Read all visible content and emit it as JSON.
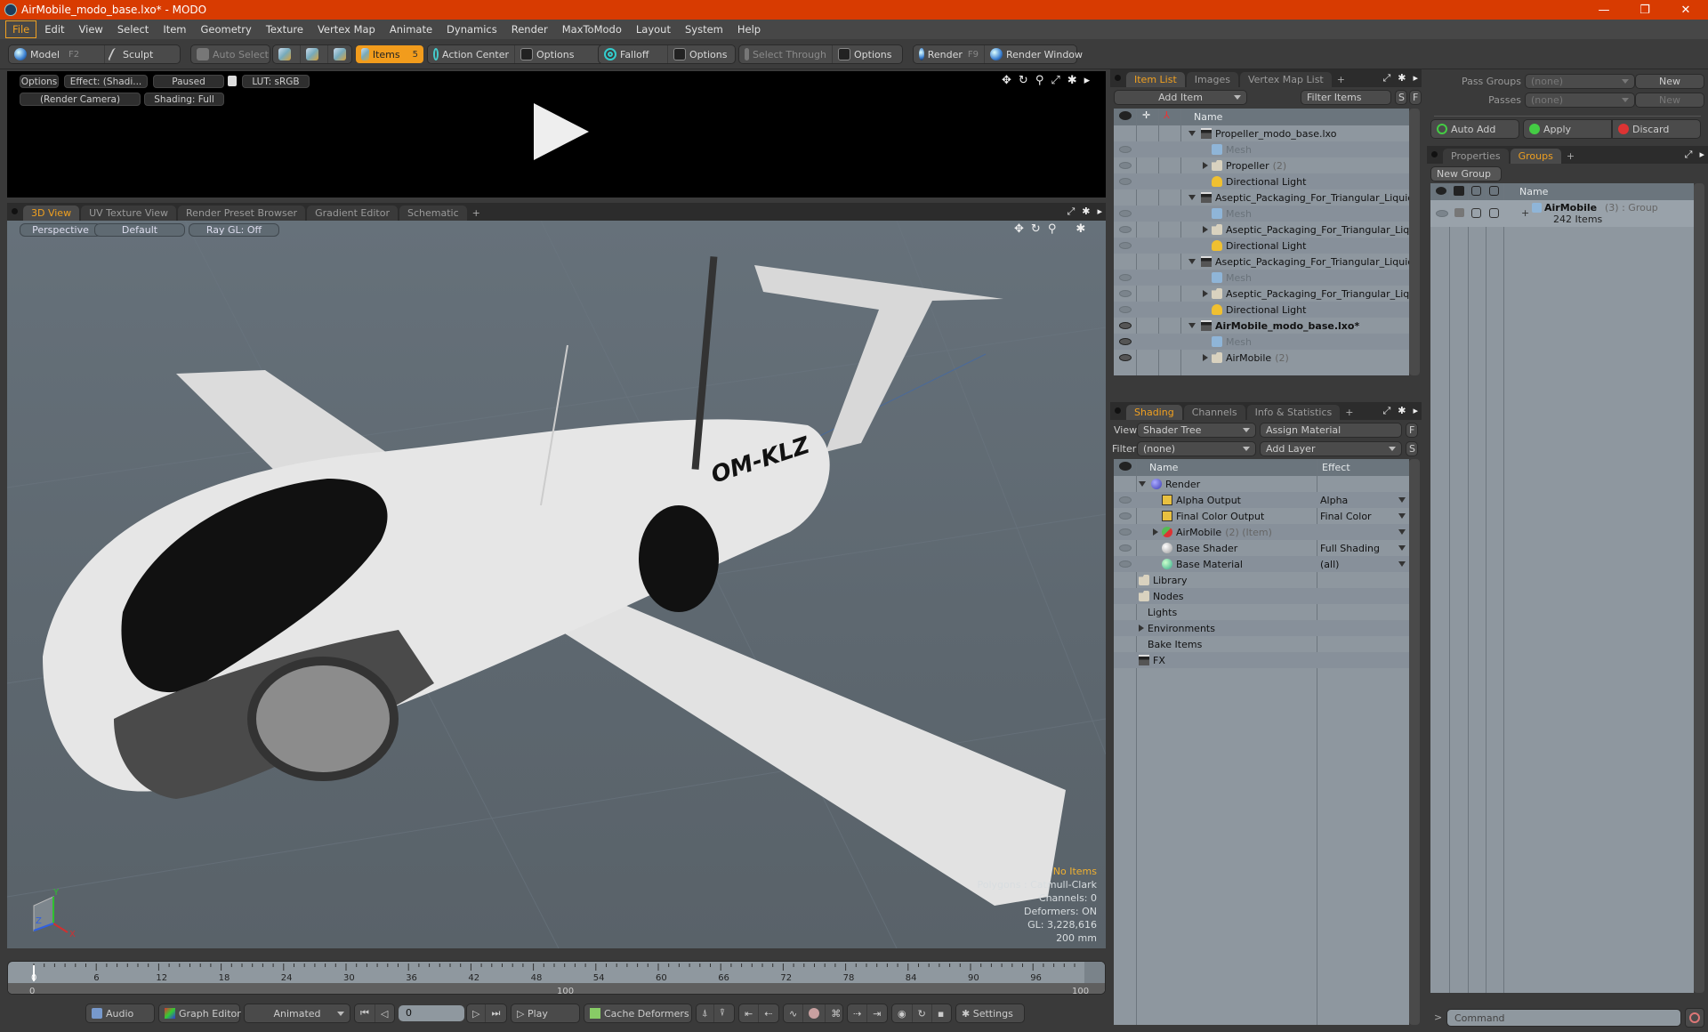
{
  "window": {
    "title": "AirMobile_modo_base.lxo* - MODO",
    "minimize_icon": "—",
    "restore_icon": "❐",
    "close_icon": "✕"
  },
  "menu": [
    "File",
    "Edit",
    "View",
    "Select",
    "Item",
    "Geometry",
    "Texture",
    "Vertex Map",
    "Animate",
    "Dynamics",
    "Render",
    "MaxToModo",
    "Layout",
    "System",
    "Help"
  ],
  "toolbar": {
    "model": "Model",
    "model_key": "F2",
    "sculpt": "Sculpt",
    "auto_select": "Auto Select",
    "items": "Items",
    "items_key": "5",
    "action_center": "Action Center",
    "options1": "Options",
    "falloff": "Falloff",
    "options2": "Options",
    "select_through": "Select Through",
    "options3": "Options",
    "render": "Render",
    "render_key": "F9",
    "render_window": "Render Window"
  },
  "preview": {
    "options": "Options",
    "effect": "Effect: (Shadi...",
    "paused": "Paused",
    "lut": "LUT: sRGB",
    "camera": "(Render Camera)",
    "shading": "Shading: Full"
  },
  "viewport_tabs": [
    "3D View",
    "UV Texture View",
    "Render Preset Browser",
    "Gradient Editor",
    "Schematic",
    "+"
  ],
  "viewport": {
    "perspective": "Perspective",
    "default": "Default",
    "raygl": "Ray GL: Off",
    "plane_label": "OM-KLZ",
    "stats": {
      "selection": "No Items",
      "polygons": "Polygons : Catmull-Clark",
      "channels": "Channels: 0",
      "deformers": "Deformers: ON",
      "gl": "GL: 3,228,616",
      "scale": "200 mm"
    },
    "axis": {
      "x": "X",
      "y": "Y",
      "z": "Z"
    }
  },
  "item_list": {
    "tabs": [
      "Item List",
      "Images",
      "Vertex Map List",
      "+"
    ],
    "add_item": "Add Item",
    "filter_items": "Filter Items",
    "s": "S",
    "f": "F",
    "col_name": "Name",
    "rows": [
      {
        "label": "Propeller_modo_base.lxo",
        "icon": "clapper",
        "indent": 0,
        "expand": "down",
        "eye": false
      },
      {
        "label": "Mesh",
        "icon": "mesh",
        "indent": 1,
        "dim": true,
        "eye": true
      },
      {
        "label": "Propeller",
        "count": "(2)",
        "icon": "folder",
        "indent": 1,
        "expand": "right",
        "eye": true
      },
      {
        "label": "Directional Light",
        "icon": "light",
        "indent": 1,
        "eye": true
      },
      {
        "label": "Aseptic_Packaging_For_Triangular_Liquid_...",
        "icon": "clapper",
        "indent": 0,
        "expand": "down",
        "eye": false
      },
      {
        "label": "Mesh",
        "icon": "mesh",
        "indent": 1,
        "dim": true,
        "eye": true
      },
      {
        "label": "Aseptic_Packaging_For_Triangular_Liqui...",
        "icon": "folder",
        "indent": 1,
        "expand": "right",
        "eye": true
      },
      {
        "label": "Directional Light",
        "icon": "light",
        "indent": 1,
        "eye": true
      },
      {
        "label": "Aseptic_Packaging_For_Triangular_Liquid_...",
        "icon": "clapper",
        "indent": 0,
        "expand": "down",
        "eye": false
      },
      {
        "label": "Mesh",
        "icon": "mesh",
        "indent": 1,
        "dim": true,
        "eye": true
      },
      {
        "label": "Aseptic_Packaging_For_Triangular_Liqui...",
        "icon": "folder",
        "indent": 1,
        "expand": "right",
        "eye": true
      },
      {
        "label": "Directional Light",
        "icon": "light",
        "indent": 1,
        "eye": true
      },
      {
        "label": "AirMobile_modo_base.lxo*",
        "icon": "clapper",
        "indent": 0,
        "expand": "down",
        "bold": true,
        "eye": true,
        "eyedark": true
      },
      {
        "label": "Mesh",
        "icon": "mesh",
        "indent": 1,
        "dim": true,
        "eye": true,
        "eyedark": true
      },
      {
        "label": "AirMobile",
        "count": "(2)",
        "icon": "folder",
        "indent": 1,
        "expand": "right",
        "eye": true,
        "eyedark": true
      }
    ]
  },
  "shading": {
    "tabs": [
      "Shading",
      "Channels",
      "Info & Statistics",
      "+"
    ],
    "view_label": "View",
    "view_value": "Shader Tree",
    "assign_material": "Assign Material",
    "f": "F",
    "filter_label": "Filter",
    "filter_value": "(none)",
    "add_layer": "Add Layer",
    "s": "S",
    "col_name": "Name",
    "col_effect": "Effect",
    "rows": [
      {
        "label": "Render",
        "icon": "render-ball",
        "indent": 0,
        "expand": "down",
        "eye": false,
        "effect": ""
      },
      {
        "label": "Alpha Output",
        "icon": "output",
        "indent": 1,
        "eye": true,
        "effect": "Alpha",
        "dd": true
      },
      {
        "label": "Final Color Output",
        "icon": "output",
        "indent": 1,
        "eye": true,
        "effect": "Final Color",
        "dd": true
      },
      {
        "label": "AirMobile",
        "count": "(2) (Item)",
        "icon": "material-group",
        "indent": 1,
        "expand": "right",
        "eye": true,
        "effect": "",
        "dd": true
      },
      {
        "label": "Base Shader",
        "icon": "shader-ball",
        "indent": 1,
        "eye": true,
        "effect": "Full Shading",
        "dd": true
      },
      {
        "label": "Base Material",
        "icon": "material-ball",
        "indent": 1,
        "eye": true,
        "effect": "(all)",
        "dd": true
      },
      {
        "label": "Library",
        "icon": "folder",
        "indent": 0,
        "eye": false,
        "effect": ""
      },
      {
        "label": "Nodes",
        "icon": "folder",
        "indent": 0,
        "eye": false,
        "effect": ""
      },
      {
        "label": "Lights",
        "icon": "",
        "indent": 0,
        "eye": false,
        "effect": ""
      },
      {
        "label": "Environments",
        "icon": "",
        "indent": 0,
        "expand": "right",
        "eye": false,
        "effect": ""
      },
      {
        "label": "Bake Items",
        "icon": "",
        "indent": 0,
        "eye": false,
        "effect": ""
      },
      {
        "label": "FX",
        "icon": "clapper",
        "indent": 0,
        "eye": false,
        "effect": ""
      }
    ]
  },
  "passes": {
    "pass_groups_label": "Pass Groups",
    "pass_groups_value": "(none)",
    "new1": "New",
    "passes_label": "Passes",
    "passes_value": "(none)",
    "new2": "New",
    "auto_add": "Auto Add",
    "apply": "Apply",
    "discard": "Discard"
  },
  "groups": {
    "tabs": [
      "Properties",
      "Groups",
      "+"
    ],
    "new_group": "New Group",
    "col_name": "Name",
    "item_name": "AirMobile",
    "item_count": "(3)",
    "item_type": ": Group",
    "item_sub": "242 Items"
  },
  "timeline": {
    "ticks": [
      "0",
      "6",
      "12",
      "18",
      "24",
      "30",
      "36",
      "42",
      "48",
      "54",
      "60",
      "66",
      "72",
      "78",
      "84",
      "90",
      "96"
    ],
    "range_start": "0",
    "range_mid": "100",
    "range_end": "100"
  },
  "bottom": {
    "audio": "Audio",
    "graph_editor": "Graph Editor",
    "animated": "Animated",
    "frame": "0",
    "play": "Play",
    "cache_deformers": "Cache Deformers",
    "settings": "Settings"
  },
  "command": {
    "prompt": ">",
    "placeholder": "Command"
  }
}
